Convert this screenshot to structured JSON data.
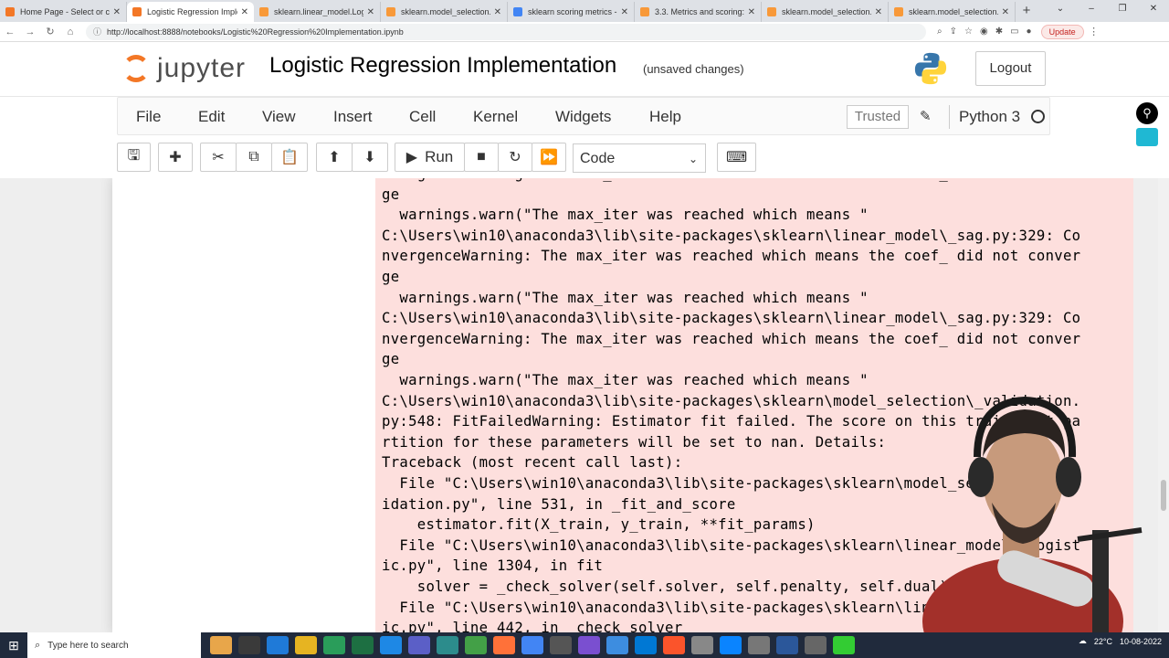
{
  "browser": {
    "tabs": [
      {
        "title": "Home Page - Select or cre",
        "color": "#f37726"
      },
      {
        "title": "Logistic Regression Imple",
        "color": "#f37726"
      },
      {
        "title": "sklearn.linear_model.Logi",
        "color": "#f89939"
      },
      {
        "title": "sklearn.model_selection.G",
        "color": "#f89939"
      },
      {
        "title": "sklearn scoring metrics - G",
        "color": "#4285f4"
      },
      {
        "title": "3.3. Metrics and scoring: q",
        "color": "#f89939"
      },
      {
        "title": "sklearn.model_selection.St",
        "color": "#f89939"
      },
      {
        "title": "sklearn.model_selection.R",
        "color": "#f89939"
      }
    ],
    "url": "http://localhost:8888/notebooks/Logistic%20Regression%20Implementation.ipynb",
    "update_label": "Update"
  },
  "header": {
    "logo_text": "jupyter",
    "notebook_title": "Logistic Regression Implementation",
    "unsaved": "(unsaved changes)",
    "logout_label": "Logout"
  },
  "menu": {
    "items": [
      "File",
      "Edit",
      "View",
      "Insert",
      "Cell",
      "Kernel",
      "Widgets",
      "Help"
    ],
    "trusted": "Trusted",
    "kernel_name": "Python 3"
  },
  "toolbar": {
    "run_label": "Run",
    "cell_type": "Code"
  },
  "output_lines": [
    "nvergenceWarning: The max_iter was reached which means the coef_ did not conver",
    "ge",
    "  warnings.warn(\"The max_iter was reached which means \"",
    "C:\\Users\\win10\\anaconda3\\lib\\site-packages\\sklearn\\linear_model\\_sag.py:329: Co",
    "nvergenceWarning: The max_iter was reached which means the coef_ did not conver",
    "ge",
    "  warnings.warn(\"The max_iter was reached which means \"",
    "C:\\Users\\win10\\anaconda3\\lib\\site-packages\\sklearn\\linear_model\\_sag.py:329: Co",
    "nvergenceWarning: The max_iter was reached which means the coef_ did not conver",
    "ge",
    "  warnings.warn(\"The max_iter was reached which means \"",
    "C:\\Users\\win10\\anaconda3\\lib\\site-packages\\sklearn\\model_selection\\_validation.",
    "py:548: FitFailedWarning: Estimator fit failed. The score on this train-test pa",
    "rtition for these parameters will be set to nan. Details:",
    "Traceback (most recent call last):",
    "  File \"C:\\Users\\win10\\anaconda3\\lib\\site-packages\\sklearn\\model_selection\\_val",
    "idation.py\", line 531, in _fit_and_score",
    "    estimator.fit(X_train, y_train, **fit_params)",
    "  File \"C:\\Users\\win10\\anaconda3\\lib\\site-packages\\sklearn\\linear_model\\_logist",
    "ic.py\", line 1304, in fit",
    "    solver = _check_solver(self.solver, self.penalty, self.dual)",
    "  File \"C:\\Users\\win10\\anaconda3\\lib\\site-packages\\sklearn\\linear_model\\_logist",
    "ic.py\", line 442, in _check_solver"
  ],
  "taskbar": {
    "search_placeholder": "Type here to search",
    "temperature": "22°C",
    "date": "10-08-2022"
  }
}
